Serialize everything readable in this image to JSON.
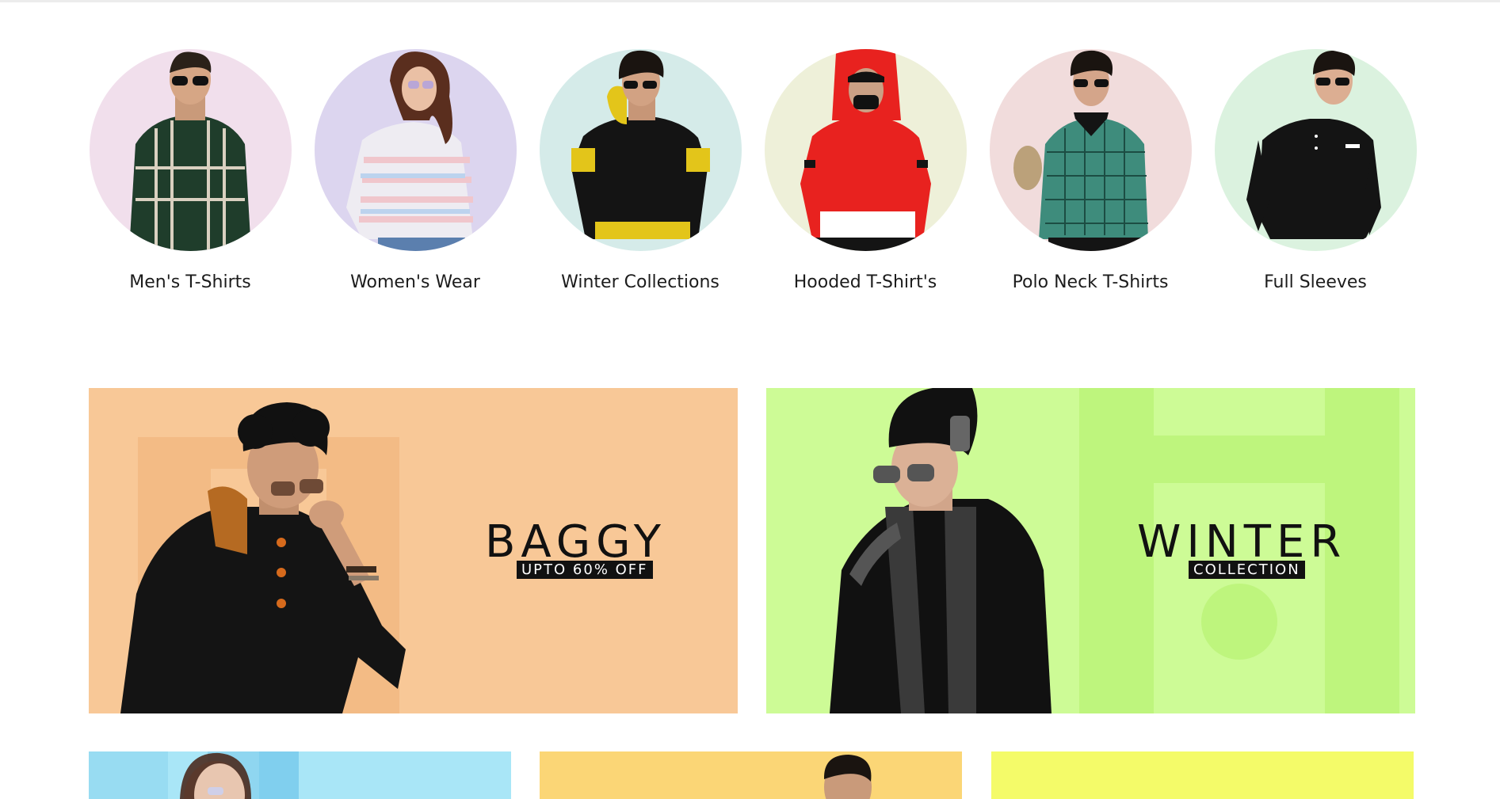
{
  "categories": [
    {
      "label": "Men's T-Shirts",
      "bg": "#f1dfec",
      "shirt": "#1f3d2b",
      "accent": "#d9d0c0"
    },
    {
      "label": "Women's Wear",
      "bg": "#dcd5ef",
      "shirt": "#e8e6ef",
      "accent": "#f0c6cc"
    },
    {
      "label": "Winter Collections",
      "bg": "#d5ebe9",
      "shirt": "#141414",
      "accent": "#e3c51a"
    },
    {
      "label": "Hooded T-Shirt's",
      "bg": "#eef0d9",
      "shirt": "#e8221f",
      "accent": "#141414"
    },
    {
      "label": "Polo Neck T-Shirts",
      "bg": "#f1dcdc",
      "shirt": "#3e8c7c",
      "accent": "#141414"
    },
    {
      "label": "Full Sleeves",
      "bg": "#dbf2df",
      "shirt": "#141414",
      "accent": "#ffffff"
    }
  ],
  "banners": {
    "baggy": {
      "title": "BAGGY",
      "tag": "UPTO 60% OFF",
      "bg": "#f8c897",
      "shade": "#f3bb85"
    },
    "winter": {
      "title": "WINTER",
      "tag": "COLLECTION",
      "bg": "#cdfb96",
      "shade": "#bef57d"
    }
  },
  "bottom_banners": [
    {
      "bg": "#a9e6f7"
    },
    {
      "bg": "#fbd676"
    },
    {
      "bg": "#f4fb69"
    }
  ]
}
